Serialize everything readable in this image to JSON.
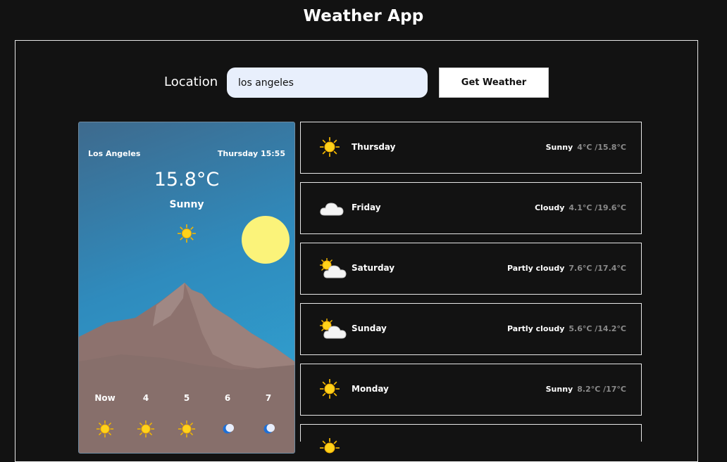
{
  "app": {
    "title": "Weather App"
  },
  "search": {
    "label": "Location",
    "value": "los angeles",
    "button_label": "Get Weather"
  },
  "current": {
    "city": "Los Angeles",
    "datetime": "Thursday 15:55",
    "temperature": "15.8°C",
    "condition": "Sunny",
    "icon": "sun-icon"
  },
  "hourly": [
    {
      "label": "Now",
      "icon": "sun-icon"
    },
    {
      "label": "4",
      "icon": "sun-icon"
    },
    {
      "label": "5",
      "icon": "sun-icon"
    },
    {
      "label": "6",
      "icon": "moon-icon"
    },
    {
      "label": "7",
      "icon": "moon-icon"
    }
  ],
  "forecast": [
    {
      "day": "Thursday",
      "condition": "Sunny",
      "temps": "4°C /15.8°C",
      "icon": "sun-icon"
    },
    {
      "day": "Friday",
      "condition": "Cloudy",
      "temps": "4.1°C /19.6°C",
      "icon": "cloud-icon"
    },
    {
      "day": "Saturday",
      "condition": "Partly cloudy",
      "temps": "7.6°C /17.4°C",
      "icon": "partly-cloudy-icon"
    },
    {
      "day": "Sunday",
      "condition": "Partly cloudy",
      "temps": "5.6°C /14.2°C",
      "icon": "partly-cloudy-icon"
    },
    {
      "day": "Monday",
      "condition": "Sunny",
      "temps": "8.2°C /17°C",
      "icon": "sun-icon"
    },
    {
      "day": "",
      "condition": "",
      "temps": "",
      "icon": "sun-icon"
    }
  ],
  "colors": {
    "background": "#121212",
    "sun": "#fbf37a",
    "mountain": "#8a6f6b",
    "input_bg": "#e8effc"
  }
}
